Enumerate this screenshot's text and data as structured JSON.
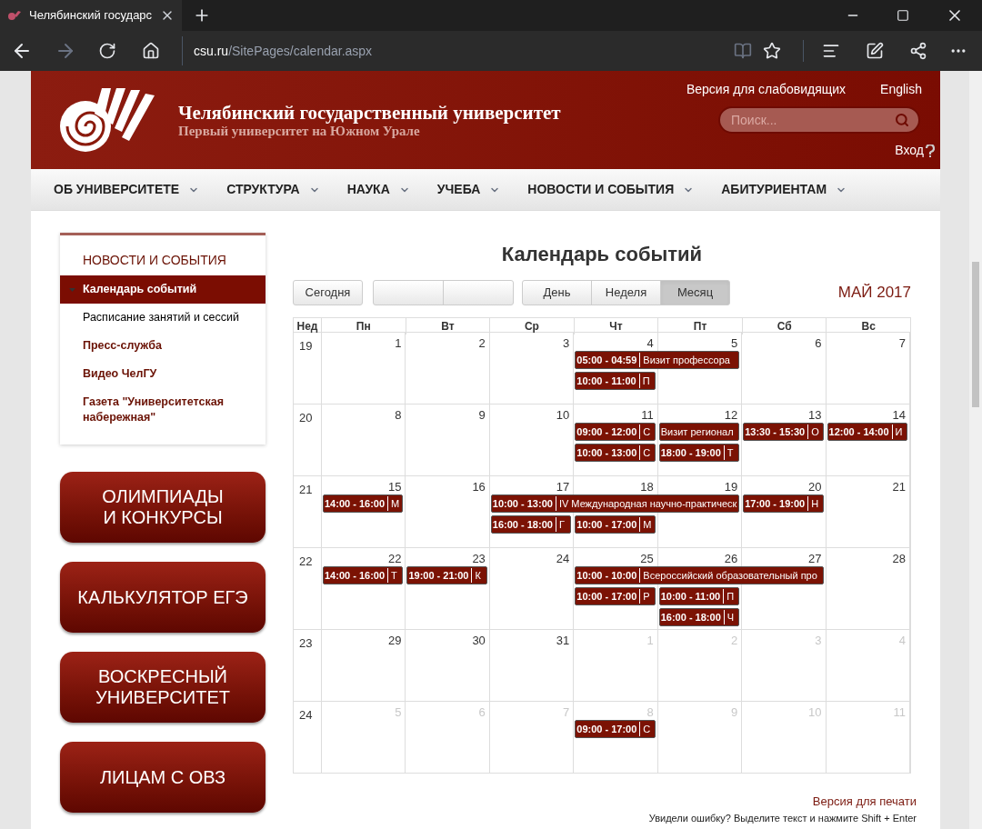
{
  "browser": {
    "tab_title": "Челябинский государс",
    "url_host": "csu.ru",
    "url_path": "/SitePages/calendar.aspx"
  },
  "header": {
    "title": "Челябинский государственный университет",
    "subtitle": "Первый университет на Южном Урале",
    "links": [
      "Версия для слабовидящих",
      "English"
    ],
    "search": {
      "placeholder": "Поиск..."
    },
    "login": "Вход"
  },
  "nav": [
    "ОБ УНИВЕРСИТЕТЕ",
    "СТРУКТУРА",
    "НАУКА",
    "УЧЕБА",
    "НОВОСТИ И СОБЫТИЯ",
    "АБИТУРИЕНТАМ"
  ],
  "sidebar": {
    "heading": "НОВОСТИ И СОБЫТИЯ",
    "items": [
      {
        "label": "Календарь событий",
        "selected": true,
        "kind": "link"
      },
      {
        "label": "Расписание занятий и сессий",
        "selected": false,
        "kind": "plain"
      },
      {
        "label": "Пресс-служба",
        "selected": false,
        "kind": "link"
      },
      {
        "label": "Видео ЧелГУ",
        "selected": false,
        "kind": "link"
      },
      {
        "label": "Газета \"Университетская набережная\"",
        "selected": false,
        "kind": "link"
      }
    ],
    "banners": [
      [
        "ОЛИМПИАДЫ",
        "И КОНКУРСЫ"
      ],
      [
        "КАЛЬКУЛЯТОР ЕГЭ"
      ],
      [
        "ВОСКРЕСНЫЙ",
        "УНИВЕРСИТЕТ"
      ],
      [
        "ЛИЦАМ С ОВЗ"
      ]
    ]
  },
  "calendar": {
    "title": "Календарь событий",
    "today_button": "Сегодня",
    "views": [
      {
        "label": "День",
        "selected": false
      },
      {
        "label": "Неделя",
        "selected": false
      },
      {
        "label": "Месяц",
        "selected": true
      }
    ],
    "period": "МАЙ 2017",
    "columns": [
      "Нед",
      "Пн",
      "Вт",
      "Ср",
      "Чт",
      "Пт",
      "Сб",
      "Вс"
    ],
    "weeks": [
      {
        "number": "19",
        "days": [
          {
            "date": "1",
            "muted": false
          },
          {
            "date": "2",
            "muted": false
          },
          {
            "date": "3",
            "muted": false
          },
          {
            "date": "4",
            "muted": false,
            "events": [
              {
                "time": "05:00 - 04:59",
                "title": "Визит профессора",
                "kind": "double"
              },
              {
                "time": "10:00 - 11:00",
                "title": "П",
                "kind": "single"
              }
            ]
          },
          {
            "date": "5",
            "muted": false
          },
          {
            "date": "6",
            "muted": false
          },
          {
            "date": "7",
            "muted": false
          }
        ]
      },
      {
        "number": "20",
        "days": [
          {
            "date": "8",
            "muted": false
          },
          {
            "date": "9",
            "muted": false
          },
          {
            "date": "10",
            "muted": false
          },
          {
            "date": "11",
            "muted": false,
            "events": [
              {
                "time": "09:00 - 12:00",
                "title": "С",
                "kind": "single"
              },
              {
                "time": "10:00 - 13:00",
                "title": "С",
                "kind": "single"
              }
            ]
          },
          {
            "date": "12",
            "muted": false,
            "events": [
              {
                "title": "Визит регионал",
                "kind": "single"
              },
              {
                "time": "18:00 - 19:00",
                "title": "Т",
                "kind": "single"
              }
            ]
          },
          {
            "date": "13",
            "muted": false,
            "events": [
              {
                "time": "13:30 - 15:30",
                "title": "О",
                "kind": "single"
              }
            ]
          },
          {
            "date": "14",
            "muted": false,
            "events": [
              {
                "time": "12:00 - 14:00",
                "title": "И",
                "kind": "single"
              }
            ]
          }
        ]
      },
      {
        "number": "21",
        "days": [
          {
            "date": "15",
            "muted": false,
            "events": [
              {
                "time": "14:00 - 16:00",
                "title": "М",
                "kind": "single"
              }
            ]
          },
          {
            "date": "16",
            "muted": false
          },
          {
            "date": "17",
            "muted": false,
            "events": [
              {
                "time": "10:00 - 13:00",
                "title": "IV Международная научно-практическ",
                "kind": "triple"
              },
              {
                "time": "16:00 - 18:00",
                "title": "Г",
                "kind": "single"
              }
            ]
          },
          {
            "date": "18",
            "muted": false,
            "events": [
              {
                "time": "10:00 - 17:00",
                "title": "М",
                "kind": "single"
              }
            ]
          },
          {
            "date": "19",
            "muted": false
          },
          {
            "date": "20",
            "muted": false,
            "events": [
              {
                "time": "17:00 - 19:00",
                "title": "Н",
                "kind": "single"
              }
            ]
          },
          {
            "date": "21",
            "muted": false
          }
        ]
      },
      {
        "number": "22",
        "days": [
          {
            "date": "22",
            "muted": false,
            "events": [
              {
                "time": "14:00 - 16:00",
                "title": "Т",
                "kind": "single"
              }
            ]
          },
          {
            "date": "23",
            "muted": false,
            "events": [
              {
                "time": "19:00 - 21:00",
                "title": "К",
                "kind": "single"
              }
            ]
          },
          {
            "date": "24",
            "muted": false
          },
          {
            "date": "25",
            "muted": false,
            "events": [
              {
                "time": "10:00 - 10:00",
                "title": "Всероссийский образовательный про",
                "kind": "triple"
              },
              {
                "time": "10:00 - 17:00",
                "title": "Р",
                "kind": "single"
              }
            ]
          },
          {
            "date": "26",
            "muted": false,
            "events": [
              {
                "time": "10:00 - 11:00",
                "title": "П",
                "kind": "single"
              },
              {
                "time": "16:00 - 18:00",
                "title": "Ч",
                "kind": "single"
              }
            ]
          },
          {
            "date": "27",
            "muted": false
          },
          {
            "date": "28",
            "muted": false
          }
        ]
      },
      {
        "number": "23",
        "days": [
          {
            "date": "29",
            "muted": false
          },
          {
            "date": "30",
            "muted": false
          },
          {
            "date": "31",
            "muted": false
          },
          {
            "date": "1",
            "muted": true
          },
          {
            "date": "2",
            "muted": true
          },
          {
            "date": "3",
            "muted": true
          },
          {
            "date": "4",
            "muted": true
          }
        ]
      },
      {
        "number": "24",
        "days": [
          {
            "date": "5",
            "muted": true
          },
          {
            "date": "6",
            "muted": true
          },
          {
            "date": "7",
            "muted": true
          },
          {
            "date": "8",
            "muted": true,
            "events": [
              {
                "time": "09:00 - 17:00",
                "title": "С",
                "kind": "single"
              }
            ]
          },
          {
            "date": "9",
            "muted": true
          },
          {
            "date": "10",
            "muted": true
          },
          {
            "date": "11",
            "muted": true
          }
        ]
      }
    ]
  },
  "footer": {
    "print_link": "Версия для печати",
    "hint": "Увидели ошибку? Выделите текст и нажмите Shift + Enter"
  }
}
